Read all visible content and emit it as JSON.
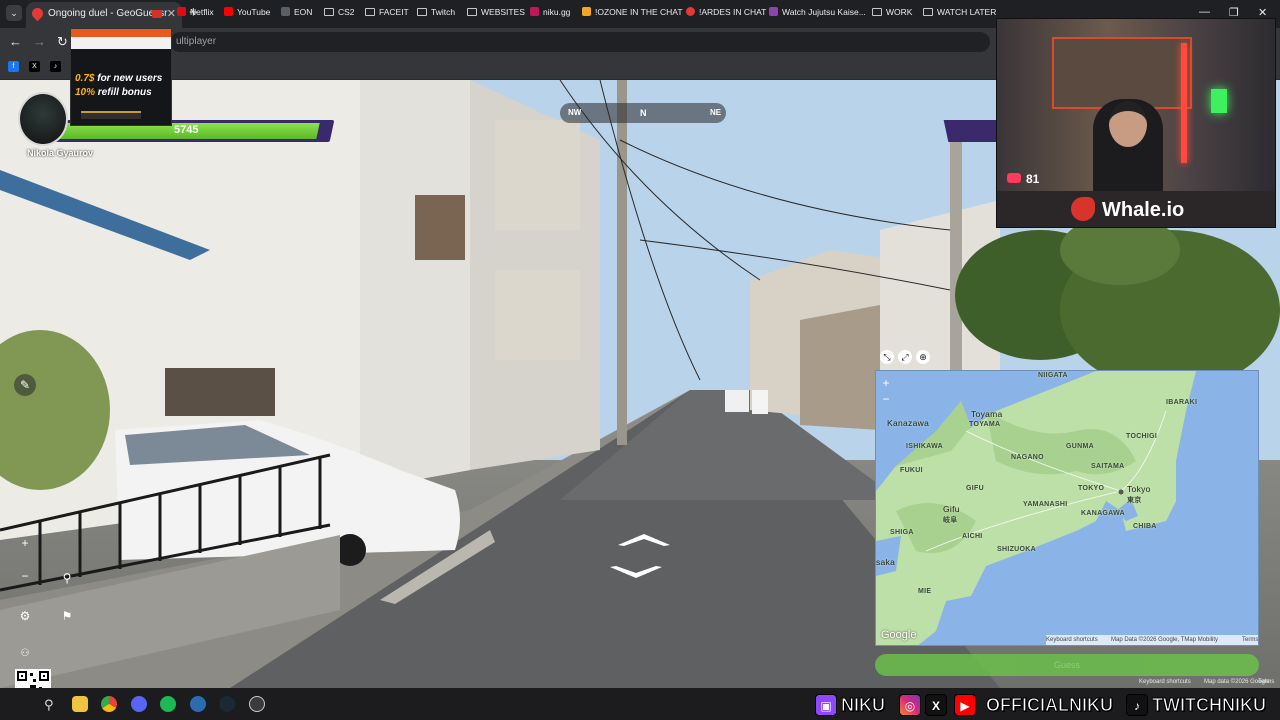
{
  "browser": {
    "tab_title": "Ongoing duel - GeoGuessr",
    "url_fragment": "ultiplayer",
    "bookmarks": [
      "Netflix",
      "YouTube",
      "EON",
      "CS2",
      "FACEIT",
      "Twitch",
      "WEBSITES",
      "niku.gg",
      "!OZONE IN THE CHAT",
      "!ARDES IN CHAT",
      "Watch Jujutsu Kaise...",
      "WORK",
      "WATCH LATER"
    ]
  },
  "game": {
    "player_name": "Nikola Gyaurov",
    "health": "5745",
    "compass": {
      "left": "NW",
      "center": "N",
      "right": "NE"
    },
    "guess_label": "Guess"
  },
  "promo": {
    "line1_value": "0.7$",
    "line1_text": " for new users",
    "line2_value": "10%",
    "line2_text": " refill bonus"
  },
  "webcam": {
    "heart_rate": "81",
    "sponsor": "Whale.io"
  },
  "map": {
    "labels": {
      "niigata": "NIIGATA",
      "toyama_city": "Toyama",
      "toyama": "TOYAMA",
      "kanazawa": "Kanazawa",
      "ishikawa": "ISHIKAWA",
      "fukui": "FUKUI",
      "nagano": "NAGANO",
      "gunma": "GUNMA",
      "tochigi": "TOCHIGI",
      "saitama": "SAITAMA",
      "tokyo_pref": "TOKYO",
      "tokyo_city": "Tokyo",
      "tokyo_kanji": "東京",
      "yamanashi": "YAMANASHI",
      "kanagawa": "KANAGAWA",
      "chiba": "CHIBA",
      "gifu_pref": "GIFU",
      "gifu_city": "Gifu",
      "gifu_kanji": "岐阜",
      "shiga": "SHIGA",
      "aichi": "AICHI",
      "shizuoka": "SHIZUOKA",
      "osaka": "saka",
      "mie": "MIE",
      "ibaraki": "IBARAKI"
    },
    "attribution_google": "Google",
    "footer_shortcuts": "Keyboard shortcuts",
    "footer_data": "Map Data ©2026 Google, TMap Mobility",
    "footer_terms": "Terms",
    "below_shortcuts": "Keyboard shortcuts",
    "below_data": "Map data ©2026 Google",
    "below_terms": "Terms"
  },
  "overlay_brand": {
    "twitch_name": "NIKU",
    "social_name": "OFFICIALNIKU",
    "tiktok_name": "TWITCHNIKU"
  },
  "colors": {
    "health_green": "#6bcb37",
    "hud_purple": "#3a2a6b",
    "map_water": "#8ab4e8",
    "map_land": "#bde0a8",
    "guess_green": "#6abf4b"
  }
}
